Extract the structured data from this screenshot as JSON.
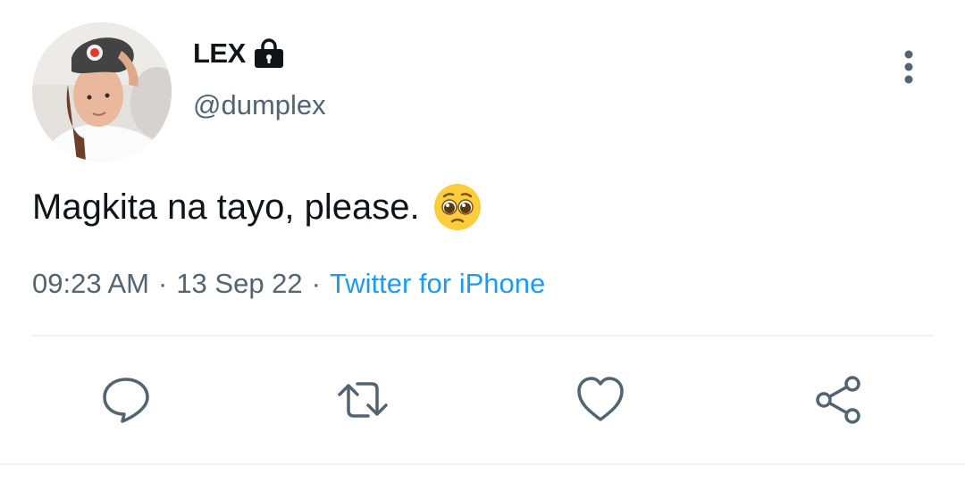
{
  "user": {
    "display_name": "LEX",
    "handle": "@dumplex",
    "protected_icon": "lock-icon",
    "avatar_icon": "profile-avatar"
  },
  "tweet": {
    "text": "Magkita na tayo, please.",
    "emoji": "pleading-face-emoji",
    "time": "09:23 AM",
    "separator": "·",
    "date": "13 Sep 22",
    "source": "Twitter for iPhone"
  },
  "actions": {
    "reply_icon": "comment-icon",
    "retweet_icon": "retweet-icon",
    "like_icon": "heart-icon",
    "share_icon": "share-icon",
    "more_icon": "more-vertical-icon"
  },
  "colors": {
    "text_primary": "#0f1419",
    "text_secondary": "#536471",
    "link": "#1d9bf0",
    "divider": "#eff3f4"
  }
}
